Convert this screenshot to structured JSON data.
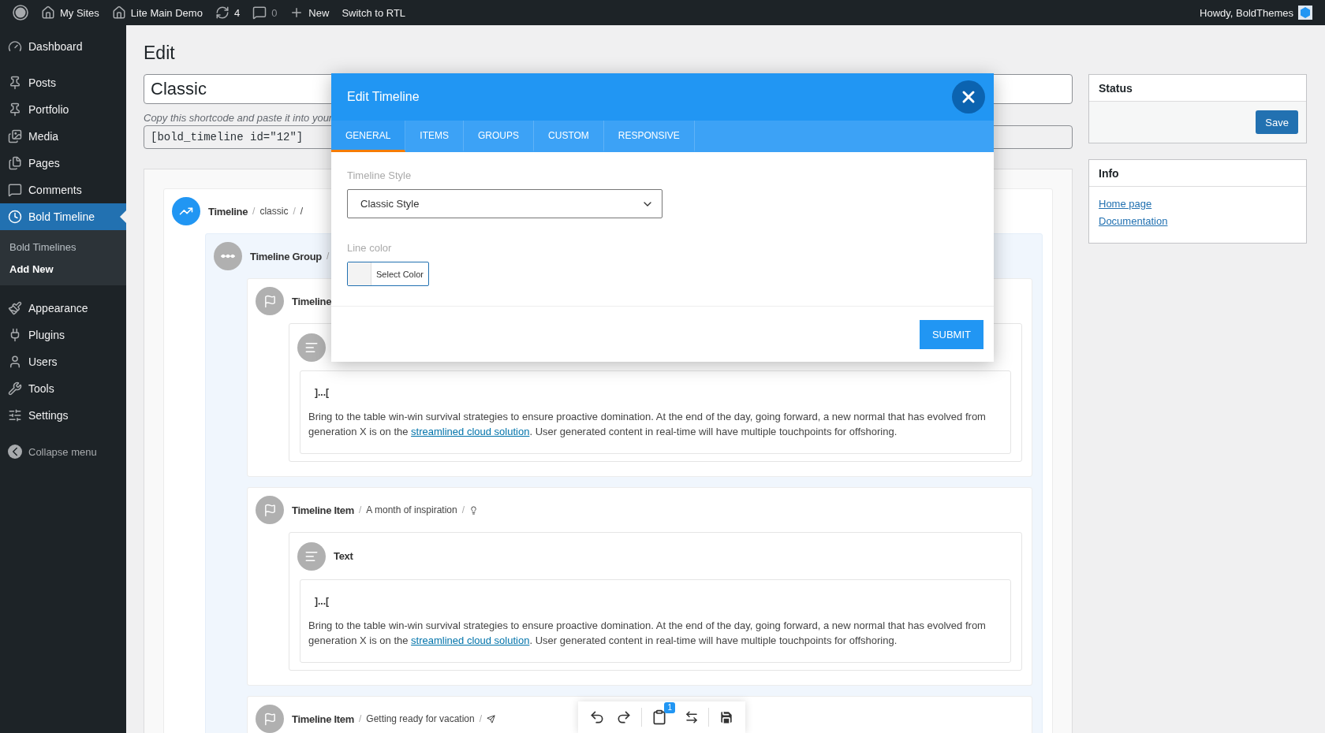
{
  "admin_bar": {
    "items": [
      {
        "label": "My Sites"
      },
      {
        "label": "Lite Main Demo"
      },
      {
        "label": "4"
      },
      {
        "label": "0"
      },
      {
        "label": "New"
      },
      {
        "label": "Switch to RTL"
      }
    ],
    "account": "Howdy, BoldThemes"
  },
  "sidebar": {
    "groups": [
      [
        {
          "label": "Dashboard",
          "selected": false
        }
      ],
      [
        {
          "label": "Posts",
          "selected": false
        },
        {
          "label": "Portfolio",
          "selected": false
        },
        {
          "label": "Media",
          "selected": false
        },
        {
          "label": "Pages",
          "selected": false
        },
        {
          "label": "Comments",
          "selected": false
        },
        {
          "label": "Bold Timeline",
          "selected": true,
          "children": [
            {
              "label": "Bold Timelines",
              "selected": false
            },
            {
              "label": "Add New",
              "selected": true
            }
          ]
        }
      ],
      [
        {
          "label": "Appearance",
          "selected": false
        },
        {
          "label": "Plugins",
          "selected": false
        },
        {
          "label": "Users",
          "selected": false
        },
        {
          "label": "Tools",
          "selected": false
        },
        {
          "label": "Settings",
          "selected": false
        }
      ]
    ],
    "collapse": "Collapse menu"
  },
  "page": {
    "heading": "Edit",
    "title_value": "Classic",
    "shortcode_hint": "Copy this shortcode and paste it into your",
    "shortcode": "[bold_timeline id=\"12\"]"
  },
  "builder": {
    "timeline": {
      "title": "Timeline",
      "trail": [
        "/",
        "classic",
        "/",
        "/"
      ]
    },
    "group": {
      "title": "Timeline Group",
      "trail": [
        "/"
      ]
    },
    "items": [
      {
        "title": "Timeline",
        "text": {
          "marker": "]...[",
          "before": "Bring to the table win-win survival strategies to ensure proactive domination. At the end of the day, going forward, a new normal that has evolved from generation X is on the ",
          "link": "streamlined cloud solution",
          "after": ". User generated content in real-time will have multiple touchpoints for offshoring."
        }
      },
      {
        "title": "Timeline Item",
        "trail": [
          "/",
          "A month of inspiration",
          "/"
        ],
        "text": {
          "title": "Text",
          "marker": "]...[",
          "before": "Bring to the table win-win survival strategies to ensure proactive domination. At the end of the day, going forward, a new normal that has evolved from generation X is on the ",
          "link": "streamlined cloud solution",
          "after": ". User generated content in real-time will have multiple touchpoints for offshoring."
        }
      },
      {
        "title": "Timeline Item",
        "trail": [
          "/",
          "Getting ready for vacation",
          "/"
        ]
      }
    ]
  },
  "toolbar": {
    "badge": "1"
  },
  "status": {
    "title": "Status",
    "button": "Save"
  },
  "info": {
    "title": "Info",
    "links": [
      "Home page",
      "Documentation"
    ]
  },
  "modal": {
    "title": "Edit Timeline",
    "tabs": [
      {
        "label": "GENERAL",
        "selected": true
      },
      {
        "label": "ITEMS",
        "selected": false
      },
      {
        "label": "GROUPS",
        "selected": false
      },
      {
        "label": "CUSTOM",
        "selected": false
      },
      {
        "label": "RESPONSIVE",
        "selected": false
      }
    ],
    "style_label": "Timeline Style",
    "style_value": "Classic Style",
    "color_label": "Line color",
    "color_button": "Select Color",
    "submit": "SUBMIT"
  }
}
